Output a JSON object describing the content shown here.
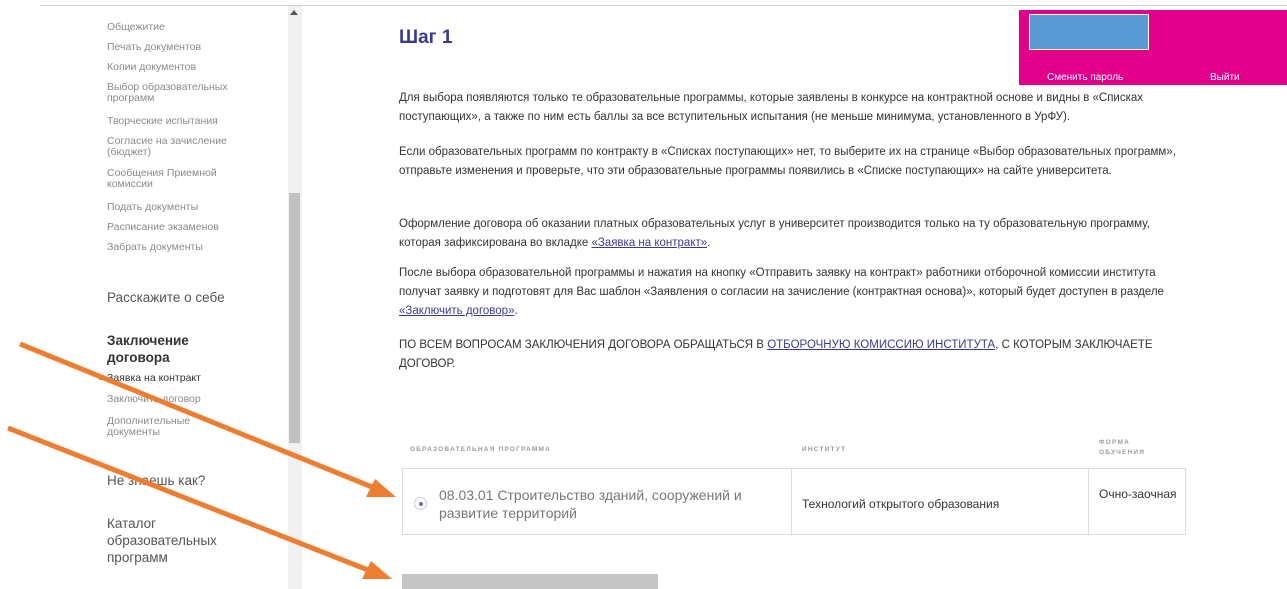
{
  "sidebar": {
    "items": [
      {
        "label": "Общежитие"
      },
      {
        "label": "Печать документов"
      },
      {
        "label": "Копии документов"
      },
      {
        "label": "Выбор образовательных программ"
      },
      {
        "label": "Творческие испытания"
      },
      {
        "label": "Согласие на зачисление (бюджет)"
      },
      {
        "label": "Сообщения Приемной комиссии"
      },
      {
        "label": "Подать документы"
      },
      {
        "label": "Расписание экзаменов"
      },
      {
        "label": "Забрать документы"
      }
    ],
    "about_heading": "Расскажите о себе",
    "contract_heading": "Заключение договора",
    "contract_items": [
      {
        "label": "Заявка на контракт"
      },
      {
        "label": "Заключить договор"
      },
      {
        "label": "Дополнительные документы"
      }
    ],
    "howto_heading": "Не знаешь как?",
    "catalog_heading": "Каталог образовательных программ"
  },
  "main": {
    "step_title": "Шаг 1",
    "p1": "Для выбора появляются только те образовательные программы, которые заявлены в конкурсе на контрактной основе и видны в «Списках поступающих», а также по ним есть баллы за все вступительных испытания (не меньше минимума, установленного в УрФУ).",
    "p2": "Если образовательных программ по контракту в «Списках поступающих» нет, то выберите их на странице «Выбор образовательных программ», отправьте изменения и проверьте, что эти образовательные программы появились в «Списке поступающих» на сайте университета.",
    "p3_before": "Оформление договора об оказании платных образовательных услуг в университет производится только на ту образовательную программу, которая зафиксирована во вкладке ",
    "p3_link": "«Заявка на контракт»",
    "p3_after": ".",
    "p4_before": "После выбора образовательной программы и нажатия на кнопку «Отправить заявку на контракт» работники отборочной комиссии института получат заявку и подготовят для Вас шаблон «Заявления о согласии на зачисление (контрактная основа)», который будет доступен в разделе ",
    "p4_link": "«Заключить договор»",
    "p4_after": ".",
    "p5_before": "ПО ВСЕМ ВОПРОСАМ ЗАКЛЮЧЕНИЯ ДОГОВОРА ОБРАЩАТЬСЯ В ",
    "p5_link": "ОТБОРОЧНУЮ КОМИССИЮ ИНСТИТУТА",
    "p5_after": ", С КОТОРЫМ ЗАКЛЮЧАЕТЕ ДОГОВОР."
  },
  "table": {
    "headers": {
      "program": "ОБРАЗОВАТЕЛЬНАЯ ПРОГРАММА",
      "institute": "ИНСТИТУТ",
      "form": "ФОРМА ОБУЧЕНИЯ"
    },
    "rows": [
      {
        "program": "08.03.01 Строительство зданий, сооружений и развитие территорий",
        "institute": "Технологий открытого образования",
        "form": "Очно-заочная"
      }
    ]
  },
  "account": {
    "change_password": "Сменить пароль",
    "logout": "Выйти"
  },
  "colors": {
    "accent": "#3a3a8c",
    "panel": "#e2008a",
    "arrow": "#ed7d31",
    "avatar": "#5b9bd5"
  }
}
